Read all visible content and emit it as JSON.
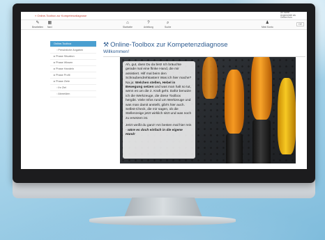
{
  "window": {
    "breadcrumb": "« Online-Toolbox zur Kompetenzdiagnose",
    "user_lines": [
      "Ihr Name",
      "Angemeldet als",
      "Online-Kurs"
    ],
    "language": "DE"
  },
  "toolbar": {
    "items": [
      {
        "icon": "edit-icon",
        "glyph": "✎",
        "label": "Bearbeiten"
      },
      {
        "icon": "grid-icon",
        "glyph": "▦",
        "label": "Navi"
      },
      {
        "icon": "home-icon",
        "glyph": "⌂",
        "label": "Startseite"
      },
      {
        "icon": "help-icon",
        "glyph": "?",
        "label": "Anleitung"
      },
      {
        "icon": "search-icon",
        "glyph": "⌕",
        "label": "Suche"
      },
      {
        "icon": "user-icon",
        "glyph": "♟",
        "label": "Mein Konto"
      }
    ]
  },
  "sidebar": {
    "items": [
      {
        "label": "Online-Toolbox",
        "active": true,
        "sub": false
      },
      {
        "label": "Persönliche Angaben",
        "active": false,
        "sub": true
      },
      {
        "label": "Phase Situation",
        "active": false,
        "sub": false
      },
      {
        "label": "Phase Wissen",
        "active": false,
        "sub": false
      },
      {
        "label": "Phase Handeln",
        "active": false,
        "sub": false
      },
      {
        "label": "Phase Profil",
        "active": false,
        "sub": false
      },
      {
        "label": "Phase Ziele",
        "active": false,
        "sub": false
      },
      {
        "label": "Ihr Ziel",
        "active": false,
        "sub": true
      },
      {
        "label": "Abmelden",
        "active": false,
        "sub": true
      }
    ]
  },
  "main": {
    "title": "Online-Toolbox zur Kompetenzdiagnose",
    "title_icon": "toolbox-icon",
    "subtitle": "Willkommen!"
  },
  "speech": {
    "p1_start": "Ah, gut, dass Du da bist! Ich bräuchte gerade mal eine flinke Hand, die mir assistiert. Hilf mal beim den Schraubendrehkasten! Was ich hier mache? Na ja: ",
    "p1_bold": "Welchen stellen, Hebel in Bewegung setzen",
    "p1_end": " und was man halt so tut, wenn es um die 2. Kraft geht. Dafür benutze ich die Werkzeuge, die diese Toolbox hergibt. Viele Infos rund um Werkzeuge und was man damit anstellt, gibt's hier auch. Selbst-Check, die mir sagen, ob die Stellenzeige jetzt wirklich sitzt und was noch zu ersetzen ist.",
    "p2_start": "Jetzt weißt du ganz! Am besten mal hier rein - ",
    "p2_italic": "wäre es doch einfach in die eigene Hand!"
  },
  "colors": {
    "accent": "#4a9fd0",
    "title": "#2c5a8f",
    "handle_orange": "#f28a14",
    "handle_yellow": "#f6c21a"
  }
}
